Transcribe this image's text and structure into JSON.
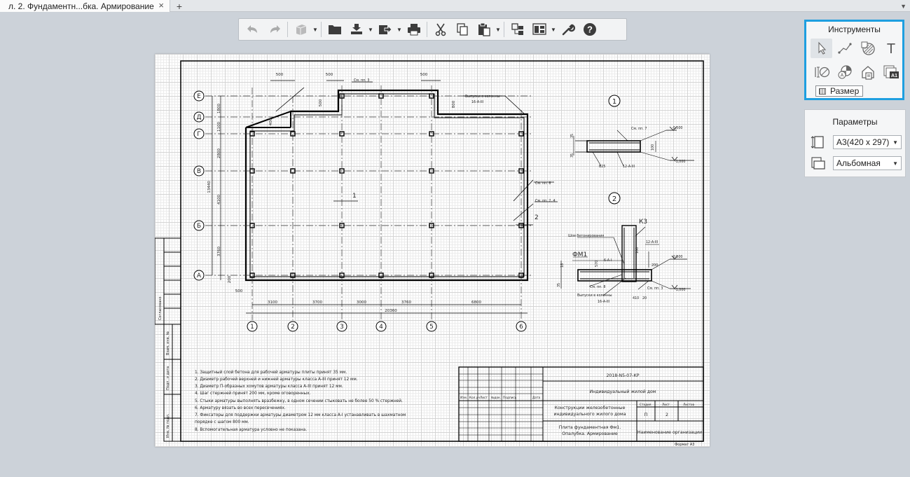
{
  "tabbar": {
    "active_tab_title": "л. 2. Фундаментн...бка. Армирование",
    "close_glyph": "×",
    "add_glyph": "+",
    "menu_glyph": "▼"
  },
  "toolbar": {
    "buttons": [
      "undo-icon",
      "redo-icon",
      "view3d-icon",
      "open-folder-icon",
      "import-icon",
      "export-icon",
      "print-icon",
      "cut-icon",
      "copy-icon",
      "paste-icon",
      "panel-toggle-icon",
      "layout-icon",
      "settings-wrench-icon",
      "help-icon"
    ],
    "help_glyph": "?"
  },
  "tools_panel": {
    "title": "Инструменты",
    "tooltip": "Размер",
    "tools": [
      "select-arrow-icon",
      "line-icon",
      "hatch-icon",
      "text-tool-icon",
      "dimension-icon",
      "symbol-icon",
      "house-view-icon",
      "sheet-format-icon"
    ],
    "text_tool_glyph": "T",
    "sheet_format_label": "A1"
  },
  "params_panel": {
    "title": "Параметры",
    "format_value": "А3(420 x 297)",
    "orientation_value": "Альбомная",
    "dropdown_glyph": "▼"
  },
  "drawing": {
    "axes_letters": [
      "Е",
      "Д",
      "Г",
      "В",
      "Б",
      "А"
    ],
    "axes_numbers": [
      "1",
      "2",
      "3",
      "4",
      "5",
      "6"
    ],
    "dims_bottom": [
      "3100",
      "3700",
      "3000",
      "3760",
      "6800"
    ],
    "dim_total": "20360",
    "dims_left": [
      "1800",
      "1100",
      "2800",
      "4100",
      "3760",
      "200"
    ],
    "dim_left_total": "13440",
    "dims_top": [
      "500",
      "500",
      "500"
    ],
    "dim_500_left": "500",
    "dim_400": "400",
    "dim_500_mid": "500",
    "dim_800": "800",
    "mark_1": "1",
    "mark_2": "2",
    "callout_sm_pp3": "См. пп. 3",
    "callout_release": "Выпуски в колонны",
    "callout_release_sub": "16-А-III",
    "callout_sm_pp8": "См. пп. 8",
    "callout_sm_pp24": "См. пп. 2, 4",
    "section1_label": "1",
    "section2_label": "2",
    "sec1_sm_pp7": "См. пп. 7",
    "sec1_elev_top": "-0,500",
    "sec1_elev_bot": "-1,000",
    "sec1_b25": "В25",
    "sec1_12a3": "12-А-III",
    "sec1_35a": "35",
    "sec1_35b": "35",
    "sec1_100": "100",
    "sec2_k3": "К3",
    "sec2_fm1": "ФМ1",
    "sec2_joint": "Шов бетонирования",
    "sec2_6a1": "6-А-I",
    "sec2_12a3": "12-А-III",
    "sec2_sm_pp8": "См. пп. 8",
    "sec2_sm_pp3": "См. пп. 3",
    "sec2_release": "Выпуски в колонны",
    "sec2_release_sub": "16-А-III",
    "sec2_elev_top": "-0,500",
    "sec2_elev_bot": "-1,000",
    "sec2_570": "570",
    "sec2_100": "100",
    "sec2_200": "200",
    "sec2_410": "410",
    "sec2_20": "20",
    "sec2_35": "35",
    "sec2_18": "18",
    "notes": [
      "1. Защитный слой бетона для рабочей арматуры плиты принят 35 мм.",
      "2. Диаметр рабочей верхней и нижней арматуры класса А-III принят 12 мм.",
      "3. Диаметр П-образных хомутов арматуры класса А-III принят 12 мм.",
      "4. Шаг стержней принят 200 мм, кроме оговоренных.",
      "5. Стыки арматуры выполнять вразбежку, в одном сечении стыковать не более 50 % стержней.",
      "6. Арматуру вязать во всех пересечениях.",
      "7. Фиксаторы для поддержки арматуры диаметром 12 мм класса А-I устанавливать в шахматном",
      "порядке с шагом 800 мм.",
      "8. Вспомогательная арматура условно не показана."
    ],
    "stamp": {
      "code": "2018-N5-07-КР",
      "object": "Индивидуальный жилой дом",
      "part_line1": "Конструкции железобетонные",
      "part_line2": "индивидуального жилого дома",
      "sheet_name_line1": "Плита фундаментная Фм1.",
      "sheet_name_line2": "Опалубка. Армирование",
      "org": "Наименование организации",
      "stage_label": "Стадия",
      "stage_value": "П",
      "sheet_label": "Лист",
      "sheet_value": "2",
      "sheets_label": "Листов",
      "col_izm": "Изм.",
      "col_kol": "Кол.уч",
      "col_list": "Лист",
      "col_ndok": "№док.",
      "col_podp": "Подпись",
      "col_data": "Дата",
      "format_label": "Формат А3"
    },
    "side_stamp": [
      "Согласовано",
      "Взам. инв. №",
      "Подп. и дата",
      "Инв. № подл."
    ]
  }
}
